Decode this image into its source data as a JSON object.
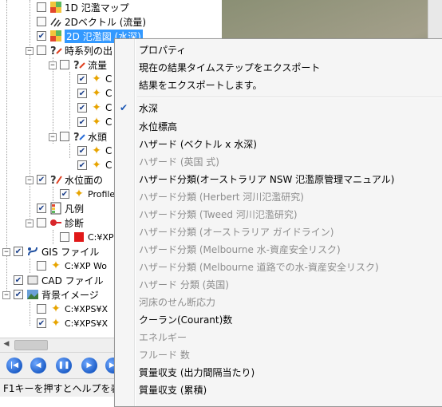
{
  "tree": {
    "items": [
      {
        "label": "1D 氾濫マップ",
        "checked": false
      },
      {
        "label": "2Dベクトル (流量)",
        "checked": false
      },
      {
        "label": "2D 氾濫図 (水深)",
        "checked": true
      },
      {
        "label": "時系列の出",
        "checked": false
      },
      {
        "label": "流量",
        "checked": false
      },
      {
        "label": "C",
        "checked": true
      },
      {
        "label": "C",
        "checked": true
      },
      {
        "label": "C",
        "checked": true
      },
      {
        "label": "C",
        "checked": true
      },
      {
        "label": "水頭",
        "checked": false
      },
      {
        "label": "C",
        "checked": true
      },
      {
        "label": "C",
        "checked": true
      },
      {
        "label": "水位面の",
        "checked": true
      },
      {
        "label": "Profile",
        "checked": true
      },
      {
        "label": "凡例",
        "checked": true
      },
      {
        "label": "診断",
        "checked": false
      },
      {
        "label": "C:¥XP",
        "checked": false
      },
      {
        "label": "GIS ファイル",
        "checked": true
      },
      {
        "label": "C:¥XP Wo",
        "checked": false
      },
      {
        "label": "CAD ファイル",
        "checked": true
      },
      {
        "label": "背景イメージ",
        "checked": true
      },
      {
        "label": "C:¥XPS¥X",
        "checked": false
      },
      {
        "label": "C:¥XPS¥X",
        "checked": true
      }
    ]
  },
  "menu": {
    "items": [
      {
        "label": "プロパティ",
        "disabled": false,
        "checked": false
      },
      {
        "label": "現在の結果タイムステップをエクスポート",
        "disabled": false,
        "checked": false
      },
      {
        "label": "結果をエクスポートします。",
        "disabled": false,
        "checked": false
      },
      {
        "label": "水深",
        "disabled": false,
        "checked": true
      },
      {
        "label": "水位標高",
        "disabled": false,
        "checked": false
      },
      {
        "label": "ハザード (ベクトル x 水深)",
        "disabled": false,
        "checked": false
      },
      {
        "label": "ハザード (英国 式)",
        "disabled": true,
        "checked": false
      },
      {
        "label": "ハザード分類(オーストラリア NSW 氾濫原管理マニュアル)",
        "disabled": false,
        "checked": false
      },
      {
        "label": "ハザード分類 (Herbert 河川氾濫研究)",
        "disabled": true,
        "checked": false
      },
      {
        "label": "ハザード分類 (Tweed 河川氾濫研究)",
        "disabled": true,
        "checked": false
      },
      {
        "label": "ハザード分類 (オーストラリア ガイドライン)",
        "disabled": true,
        "checked": false
      },
      {
        "label": "ハザード分類 (Melbourne 水-資産安全リスク)",
        "disabled": true,
        "checked": false
      },
      {
        "label": "ハザード分類 (Melbourne 道路での水-資産安全リスク)",
        "disabled": true,
        "checked": false
      },
      {
        "label": "ハザード 分類 (英国)",
        "disabled": true,
        "checked": false
      },
      {
        "label": "河床のせん断応力",
        "disabled": true,
        "checked": false
      },
      {
        "label": "クーラン(Courant)数",
        "disabled": false,
        "checked": false
      },
      {
        "label": "エネルギー",
        "disabled": true,
        "checked": false
      },
      {
        "label": "フルード 数",
        "disabled": true,
        "checked": false
      },
      {
        "label": "質量収支 (出力間隔当たり)",
        "disabled": false,
        "checked": false
      },
      {
        "label": "質量収支 (累積)",
        "disabled": false,
        "checked": false
      }
    ]
  },
  "status": {
    "text": "F1キーを押すとヘルプを表"
  },
  "colors": {
    "accent": "#3399ff",
    "menu_bg": "#f5f5f5",
    "disabled_text": "#8d8d8d",
    "player_button": "#1f5fc8"
  }
}
